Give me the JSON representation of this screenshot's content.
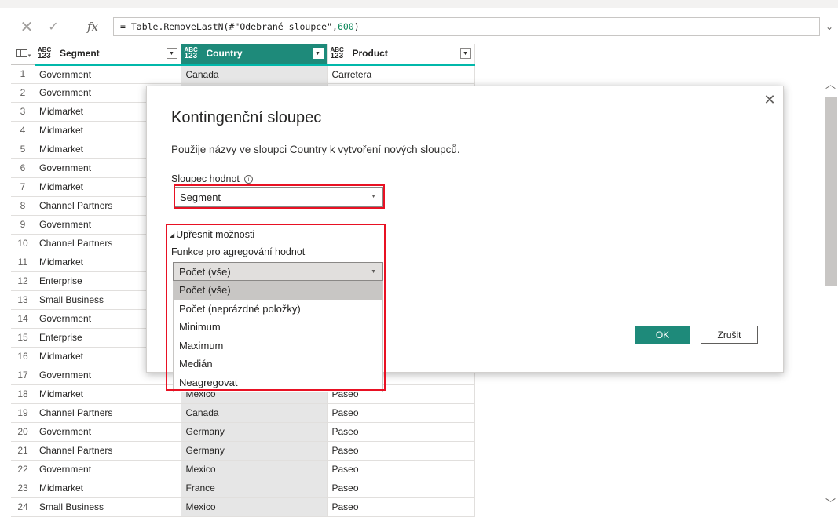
{
  "formula_bar": {
    "cancel_icon": "close-icon",
    "commit_icon": "check-icon",
    "fx_label": "fx",
    "formula_prefix": "= Table.RemoveLastN(#\"Odebrané sloupce\",",
    "formula_number": "600",
    "formula_suffix": ")",
    "expand_icon": "chevron-down-icon"
  },
  "table": {
    "type_label_top": "ABC",
    "type_label_bottom": "123",
    "columns": [
      "Segment",
      "Country",
      "Product"
    ],
    "rows": [
      {
        "n": "1",
        "segment": "Government",
        "country": "Canada",
        "product": "Carretera"
      },
      {
        "n": "2",
        "segment": "Government",
        "country": "",
        "product": ""
      },
      {
        "n": "3",
        "segment": "Midmarket",
        "country": "",
        "product": ""
      },
      {
        "n": "4",
        "segment": "Midmarket",
        "country": "",
        "product": ""
      },
      {
        "n": "5",
        "segment": "Midmarket",
        "country": "",
        "product": ""
      },
      {
        "n": "6",
        "segment": "Government",
        "country": "",
        "product": ""
      },
      {
        "n": "7",
        "segment": "Midmarket",
        "country": "",
        "product": ""
      },
      {
        "n": "8",
        "segment": "Channel Partners",
        "country": "",
        "product": ""
      },
      {
        "n": "9",
        "segment": "Government",
        "country": "",
        "product": ""
      },
      {
        "n": "10",
        "segment": "Channel Partners",
        "country": "",
        "product": ""
      },
      {
        "n": "11",
        "segment": "Midmarket",
        "country": "",
        "product": ""
      },
      {
        "n": "12",
        "segment": "Enterprise",
        "country": "",
        "product": ""
      },
      {
        "n": "13",
        "segment": "Small Business",
        "country": "",
        "product": ""
      },
      {
        "n": "14",
        "segment": "Government",
        "country": "",
        "product": ""
      },
      {
        "n": "15",
        "segment": "Enterprise",
        "country": "",
        "product": ""
      },
      {
        "n": "16",
        "segment": "Midmarket",
        "country": "",
        "product": ""
      },
      {
        "n": "17",
        "segment": "Government",
        "country": "",
        "product": ""
      },
      {
        "n": "18",
        "segment": "Midmarket",
        "country": "Mexico",
        "product": "Paseo"
      },
      {
        "n": "19",
        "segment": "Channel Partners",
        "country": "Canada",
        "product": "Paseo"
      },
      {
        "n": "20",
        "segment": "Government",
        "country": "Germany",
        "product": "Paseo"
      },
      {
        "n": "21",
        "segment": "Channel Partners",
        "country": "Germany",
        "product": "Paseo"
      },
      {
        "n": "22",
        "segment": "Government",
        "country": "Mexico",
        "product": "Paseo"
      },
      {
        "n": "23",
        "segment": "Midmarket",
        "country": "France",
        "product": "Paseo"
      },
      {
        "n": "24",
        "segment": "Small Business",
        "country": "Mexico",
        "product": "Paseo"
      }
    ]
  },
  "dialog": {
    "title": "Kontingenční sloupec",
    "description": "Použije názvy ve sloupci Country k vytvoření nových sloupců.",
    "values_label": "Sloupec hodnot",
    "values_selected": "Segment",
    "advanced_label": "Upřesnit možnosti",
    "agg_label": "Funkce pro agregování hodnot",
    "agg_selected": "Počet (vše)",
    "agg_options": [
      "Počet (vše)",
      "Počet (neprázdné položky)",
      "Minimum",
      "Maximum",
      "Medián",
      "Neagregovat"
    ],
    "ok_label": "OK",
    "cancel_label": "Zrušit",
    "close_icon": "close-icon",
    "info_icon": "info-icon",
    "highlight_color": "#e81123"
  },
  "colors": {
    "accent": "#1e8a7a",
    "column_quality_bar": "#01b8aa"
  }
}
